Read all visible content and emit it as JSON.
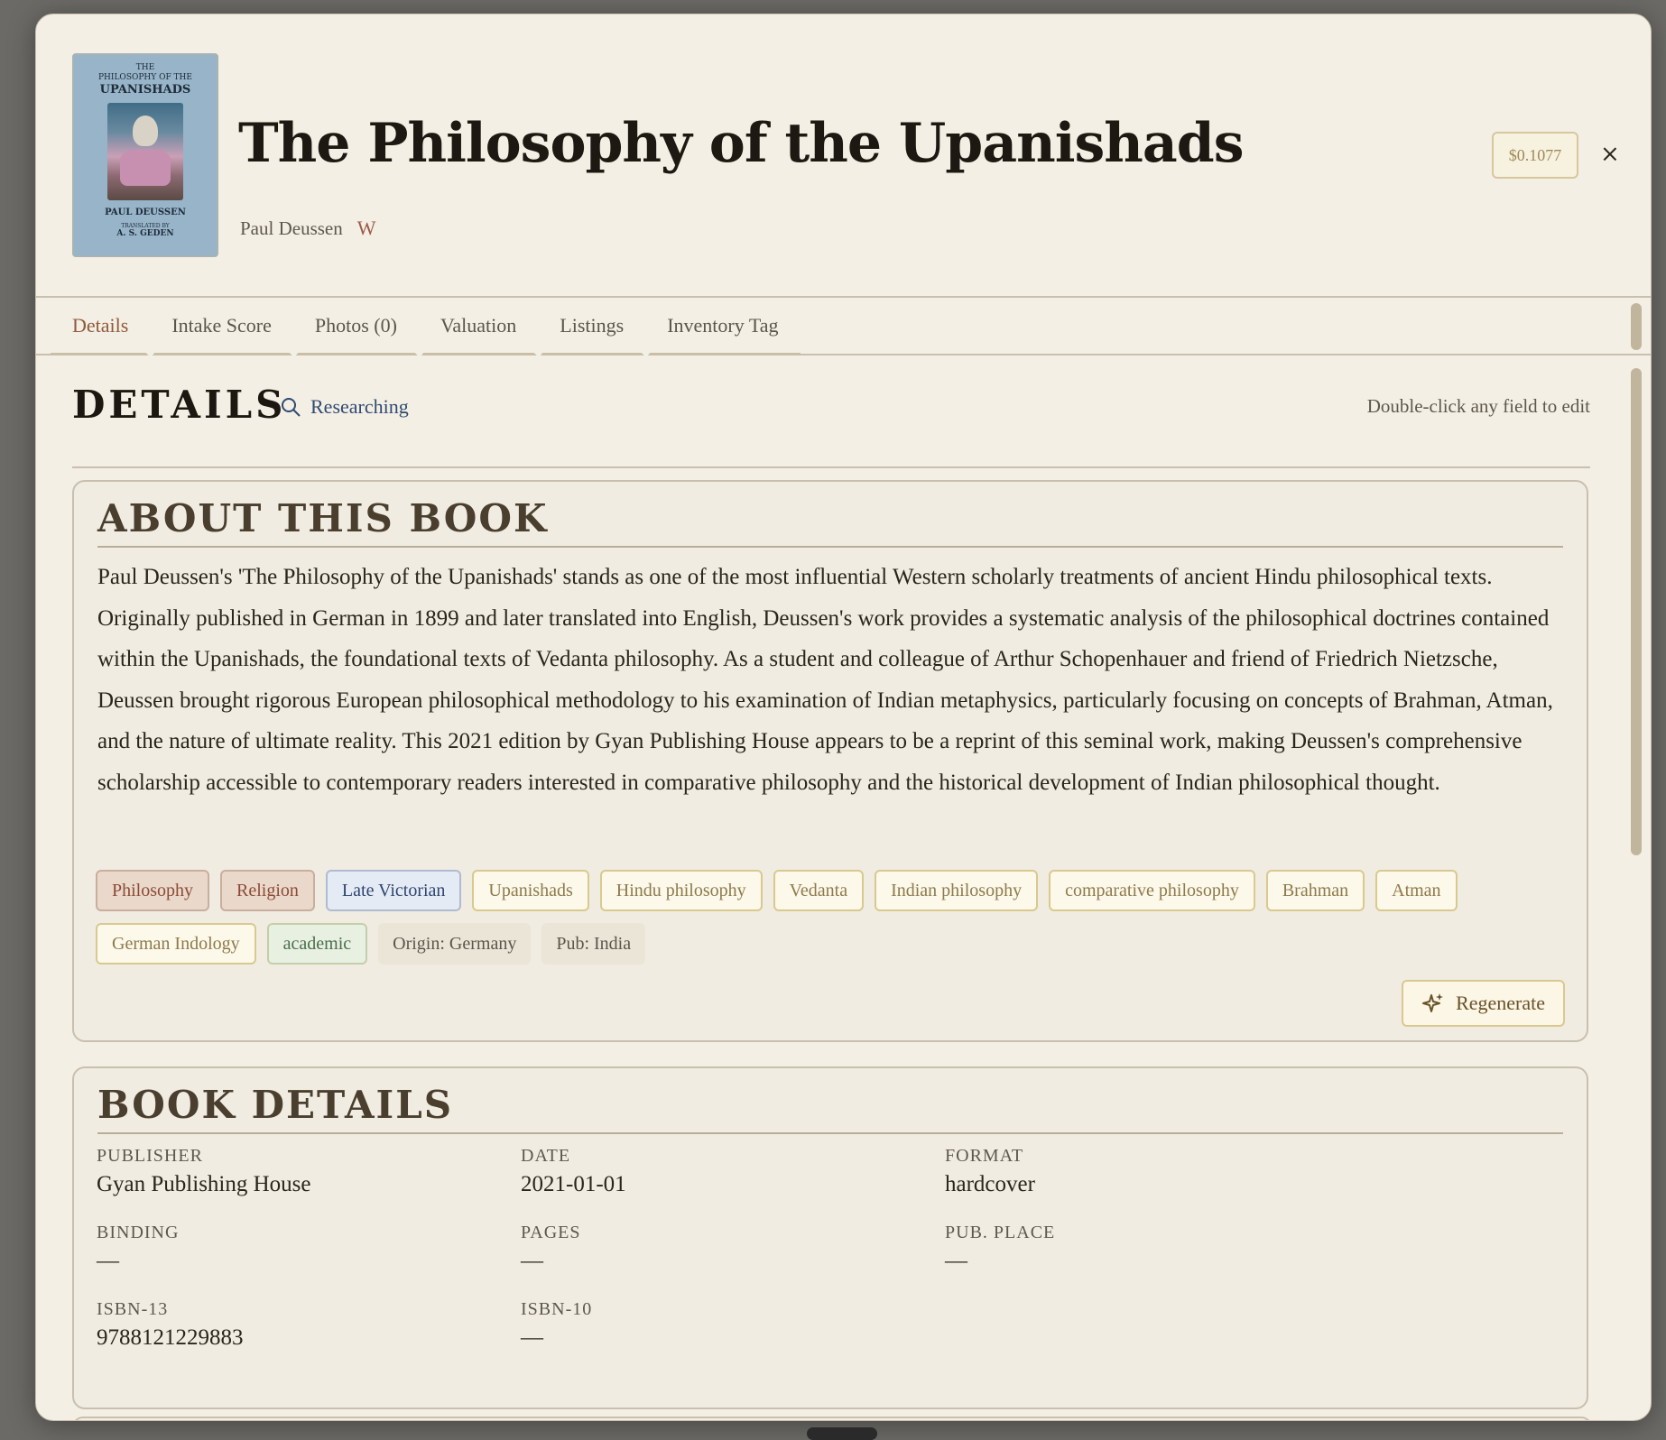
{
  "book": {
    "title": "The Philosophy of the Upanishads",
    "author": "Paul Deussen",
    "wiki_label": "W",
    "cost_label": "$0.1077",
    "close_label": "×",
    "cover": {
      "line1": "THE",
      "line2": "PHILOSOPHY OF THE",
      "line3": "UPANISHADS",
      "author": "PAUL DEUSSEN",
      "translated_by": "TRANSLATED BY",
      "translator": "A. S. GEDEN"
    }
  },
  "tabs": [
    {
      "label": "Details",
      "active": true
    },
    {
      "label": "Intake Score"
    },
    {
      "label": "Photos (0)"
    },
    {
      "label": "Valuation"
    },
    {
      "label": "Listings"
    },
    {
      "label": "Inventory Tag"
    }
  ],
  "details": {
    "heading": "DETAILS",
    "status": "Researching",
    "status_icon": "search-icon",
    "hint": "Double-click any field to edit"
  },
  "about": {
    "heading": "ABOUT THIS BOOK",
    "description": "Paul Deussen's 'The Philosophy of the Upanishads' stands as one of the most influential Western scholarly treatments of ancient Hindu philosophical texts. Originally published in German in 1899 and later translated into English, Deussen's work provides a systematic analysis of the philosophical doctrines contained within the Upanishads, the foundational texts of Vedanta philosophy. As a student and colleague of Arthur Schopenhauer and friend of Friedrich Nietzsche, Deussen brought rigorous European philosophical methodology to his examination of Indian metaphysics, particularly focusing on concepts of Brahman, Atman, and the nature of ultimate reality. This 2021 edition by Gyan Publishing House appears to be a reprint of this seminal work, making Deussen's comprehensive scholarship accessible to contemporary readers interested in comparative philosophy and the historical development of Indian philosophical thought.",
    "tags": [
      {
        "label": "Philosophy",
        "kind": "cat"
      },
      {
        "label": "Religion",
        "kind": "cat"
      },
      {
        "label": "Late Victorian",
        "kind": "era"
      },
      {
        "label": "Upanishads",
        "kind": "kw"
      },
      {
        "label": "Hindu philosophy",
        "kind": "kw"
      },
      {
        "label": "Vedanta",
        "kind": "kw"
      },
      {
        "label": "Indian philosophy",
        "kind": "kw"
      },
      {
        "label": "comparative philosophy",
        "kind": "kw"
      },
      {
        "label": "Brahman",
        "kind": "kw"
      },
      {
        "label": "Atman",
        "kind": "kw"
      },
      {
        "label": "German Indology",
        "kind": "kw"
      },
      {
        "label": "academic",
        "kind": "aud"
      },
      {
        "label": "Origin: Germany",
        "kind": "meta"
      },
      {
        "label": "Pub: India",
        "kind": "meta"
      }
    ],
    "regenerate_label": "Regenerate",
    "regenerate_icon": "sparkle-icon"
  },
  "book_details": {
    "heading": "BOOK DETAILS",
    "fields": [
      {
        "label": "PUBLISHER",
        "value": "Gyan Publishing House"
      },
      {
        "label": "DATE",
        "value": "2021-01-01"
      },
      {
        "label": "FORMAT",
        "value": "hardcover"
      },
      {
        "label": "BINDING",
        "value": "—"
      },
      {
        "label": "PAGES",
        "value": "—"
      },
      {
        "label": "PUB. PLACE",
        "value": "—"
      },
      {
        "label": "ISBN-13",
        "value": "9788121229883"
      },
      {
        "label": "ISBN-10",
        "value": "—"
      }
    ]
  },
  "colors": {
    "background": "#f4efe4",
    "accent": "#8e5b3b",
    "link": "#2f4a72"
  }
}
